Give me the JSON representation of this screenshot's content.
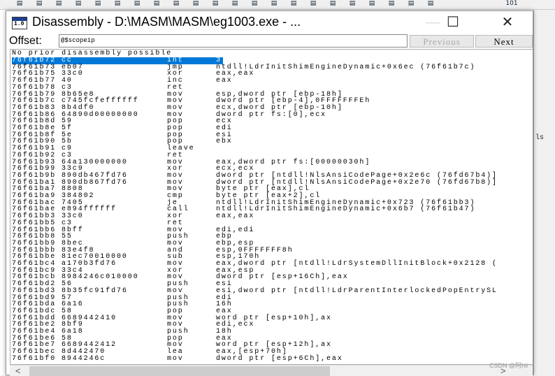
{
  "background_toolbar_icons": [
    "cut-icon",
    "copy-icon",
    "paste-icon",
    "step-into-icon",
    "step-over-icon",
    "step-out-icon",
    "run-to-cursor-icon",
    "brace-icon",
    "brace-step-icon",
    "brace-out-icon",
    "brace-run-icon",
    "hand-icon",
    "window-icon",
    "registers-icon",
    "memory-icon",
    "stack-icon",
    "disasm-icon",
    "scratch-icon",
    "processes-icon",
    "source-mode-icon",
    "font-icon",
    "options-icon"
  ],
  "background_toolbar_label": "101",
  "background_side_text": "ls",
  "window": {
    "title": "Disassembly - D:\\MASM\\MASM\\eg1003.exe - ...",
    "minimize": "—",
    "maximize": "☐",
    "close": "✕"
  },
  "offset": {
    "label": "Offset:",
    "value": "@$scopeip",
    "previous": "Previous",
    "next": "Next"
  },
  "no_prior": "No prior disassembly possible",
  "selected_color": "#0078d7",
  "rows": [
    [
      "76f61b72",
      "cc",
      "int",
      "3"
    ],
    [
      "76f61b73",
      "eb07",
      "jmp",
      "ntdll!LdrInitShimEngineDynamic+0x6ec (76f61b7c)"
    ],
    [
      "76f61b75",
      "33c0",
      "xor",
      "eax,eax"
    ],
    [
      "76f61b77",
      "40",
      "inc",
      "eax"
    ],
    [
      "76f61b78",
      "c3",
      "ret",
      ""
    ],
    [
      "76f61b79",
      "8b65e8",
      "mov",
      "esp,dword ptr [ebp-18h]"
    ],
    [
      "76f61b7c",
      "c745fcfeffffff",
      "mov",
      "dword ptr [ebp-4],0FFFFFFFEh"
    ],
    [
      "76f61b83",
      "8b4df0",
      "mov",
      "ecx,dword ptr [ebp-10h]"
    ],
    [
      "76f61b86",
      "64890d00000000",
      "mov",
      "dword ptr fs:[0],ecx"
    ],
    [
      "76f61b8d",
      "59",
      "pop",
      "ecx"
    ],
    [
      "76f61b8e",
      "5f",
      "pop",
      "edi"
    ],
    [
      "76f61b8f",
      "5e",
      "pop",
      "esi"
    ],
    [
      "76f61b90",
      "5b",
      "pop",
      "ebx"
    ],
    [
      "76f61b91",
      "c9",
      "leave",
      ""
    ],
    [
      "76f61b92",
      "c3",
      "ret",
      ""
    ],
    [
      "76f61b93",
      "64a130000000",
      "mov",
      "eax,dword ptr fs:[00000030h]"
    ],
    [
      "76f61b99",
      "33c9",
      "xor",
      "ecx,ecx"
    ],
    [
      "76f61b9b",
      "890db467fd76",
      "mov",
      "dword ptr [ntdll!NlsAnsiCodePage+0x2e6c (76fd67b4)]"
    ],
    [
      "76f61ba1",
      "890db867fd76",
      "mov",
      "dword ptr [ntdll!NlsAnsiCodePage+0x2e70 (76fd67b8)]"
    ],
    [
      "76f61ba7",
      "8808",
      "mov",
      "byte ptr [eax],cl"
    ],
    [
      "76f61ba9",
      "384802",
      "cmp",
      "byte ptr [eax+2],cl"
    ],
    [
      "76f61bac",
      "7405",
      "je",
      "ntdll!LdrInitShimEngineDynamic+0x723 (76f61bb3)"
    ],
    [
      "76f61bae",
      "e894ffffff",
      "call",
      "ntdll!LdrInitShimEngineDynamic+0x6b7 (76f61b47)"
    ],
    [
      "76f61bb3",
      "33c0",
      "xor",
      "eax,eax"
    ],
    [
      "76f61bb5",
      "c3",
      "ret",
      ""
    ],
    [
      "76f61bb6",
      "8bff",
      "mov",
      "edi,edi"
    ],
    [
      "76f61bb8",
      "55",
      "push",
      "ebp"
    ],
    [
      "76f61bb9",
      "8bec",
      "mov",
      "ebp,esp"
    ],
    [
      "76f61bbb",
      "83e4f8",
      "and",
      "esp,0FFFFFFF8h"
    ],
    [
      "76f61bbe",
      "81ec70010000",
      "sub",
      "esp,170h"
    ],
    [
      "76f61bc4",
      "a170b3fd76",
      "mov",
      "eax,dword ptr [ntdll!LdrSystemDllInitBlock+0x2128 ("
    ],
    [
      "76f61bc9",
      "33c4",
      "xor",
      "eax,esp"
    ],
    [
      "76f61bcb",
      "8984246c010000",
      "mov",
      "dword ptr [esp+16Ch],eax"
    ],
    [
      "76f61bd2",
      "56",
      "push",
      "esi"
    ],
    [
      "76f61bd3",
      "8b35fc91fd76",
      "mov",
      "esi,dword ptr [ntdll!LdrParentInterlockedPopEntrySL"
    ],
    [
      "76f61bd9",
      "57",
      "push",
      "edi"
    ],
    [
      "76f61bda",
      "6a16",
      "push",
      "16h"
    ],
    [
      "76f61bdc",
      "58",
      "pop",
      "eax"
    ],
    [
      "76f61bdd",
      "6689442410",
      "mov",
      "word ptr [esp+10h],ax"
    ],
    [
      "76f61be2",
      "8bf9",
      "mov",
      "edi,ecx"
    ],
    [
      "76f61be4",
      "6a18",
      "push",
      "18h"
    ],
    [
      "76f61be6",
      "58",
      "pop",
      "eax"
    ],
    [
      "76f61be7",
      "6689442412",
      "mov",
      "word ptr [esp+12h],ax"
    ],
    [
      "76f61bec",
      "8d442470",
      "lea",
      "eax,[esp+70h]"
    ],
    [
      "76f61bf0",
      "8944246c",
      "mov",
      "dword ptr [esp+6Ch],eax"
    ]
  ],
  "scroll": {
    "left": "<",
    "right": ">"
  },
  "watermark": "CSDN @阿hii"
}
